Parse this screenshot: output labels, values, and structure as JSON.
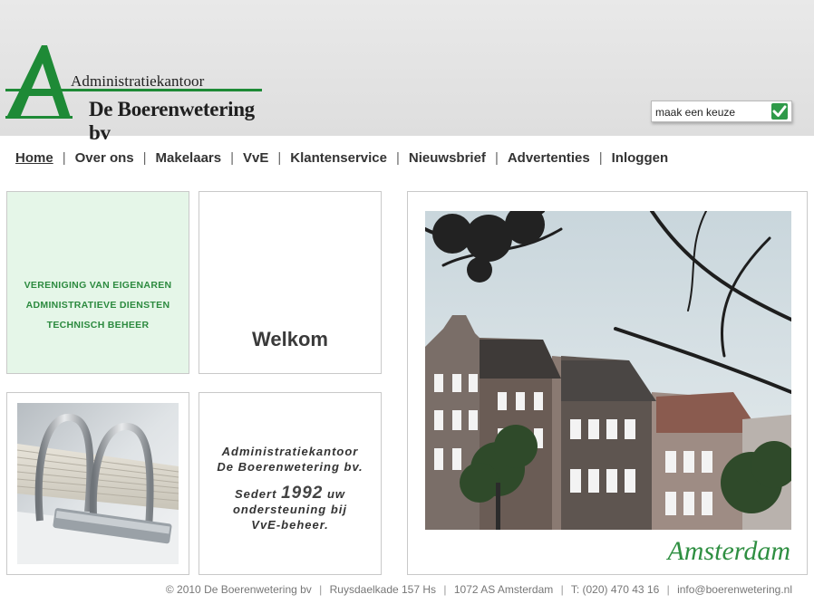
{
  "logo": {
    "line1": "Administratiekantoor",
    "line2": "De Boerenwetering bv",
    "letter": "A",
    "brand_color": "#1e8a36"
  },
  "select": {
    "value": "maak een keuze",
    "submit_icon": "checkmark-icon"
  },
  "nav": {
    "items": [
      {
        "label": "Home",
        "active": true
      },
      {
        "label": "Over ons"
      },
      {
        "label": "Makelaars"
      },
      {
        "label": "VvE"
      },
      {
        "label": "Klantenservice"
      },
      {
        "label": "Nieuwsbrief"
      },
      {
        "label": "Advertenties"
      },
      {
        "label": "Inloggen"
      }
    ],
    "separator": "|"
  },
  "services": {
    "lines": [
      "VERENIGING VAN EIGENAREN",
      "ADMINISTRATIEVE DIENSTEN",
      "TECHNISCH BEHEER"
    ]
  },
  "welcome": {
    "title": "Welkom"
  },
  "about": {
    "line1": "Administratiekantoor",
    "line2": "De Boerenwetering bv.",
    "line3_pre": "Sedert",
    "year": "1992",
    "line3_post": "uw",
    "line4": "ondersteuning bij",
    "line5": "VvE-beheer."
  },
  "photo": {
    "caption": "Amsterdam"
  },
  "footer": {
    "items": [
      "© 2010 De Boerenwetering bv",
      "Ruysdaelkade 157 Hs",
      "1072 AS Amsterdam",
      "T: (020) 470 43 16",
      "info@boerenwetering.nl"
    ],
    "separator": "|"
  },
  "colors": {
    "accent_green": "#2c8a3f",
    "green_panel": "#e5f6e8",
    "header_bg": "#e3e3e3"
  }
}
